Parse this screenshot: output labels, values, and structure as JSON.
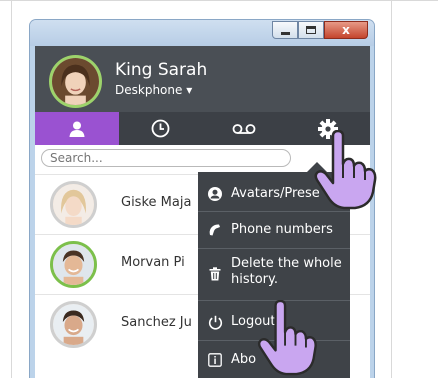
{
  "window": {
    "close_glyph": "x"
  },
  "user": {
    "name": "King Sarah",
    "device": "Deskphone ▾"
  },
  "tabs": [
    {
      "name": "contacts",
      "icon": "person-icon",
      "active": true
    },
    {
      "name": "history",
      "icon": "clock-icon",
      "active": false
    },
    {
      "name": "voicemail",
      "icon": "voicemail-icon",
      "active": false
    },
    {
      "name": "settings",
      "icon": "gear-icon",
      "active": false
    }
  ],
  "search": {
    "placeholder": "Search..."
  },
  "contacts": [
    {
      "name": "Giske Maja",
      "online": false
    },
    {
      "name": "Morvan Pi",
      "online": true
    },
    {
      "name": "Sanchez Ju",
      "online": false
    }
  ],
  "menu": {
    "items": [
      {
        "label": "Avatars/Prese",
        "icon": "avatar-icon"
      },
      {
        "label": "Phone numbers",
        "icon": "phone-icon"
      },
      {
        "label": "Delete the whole history.",
        "line1": "Delete the whole",
        "line2": "history.",
        "icon": "trash-icon"
      },
      {
        "label": "Logout",
        "icon": "power-icon"
      },
      {
        "label": "Abo",
        "icon": "info-icon"
      }
    ]
  },
  "colors": {
    "header_bg": "#4a4f55",
    "tab_active": "#9a52d1",
    "menu_bg": "#3f4348",
    "online_ring": "#7cc04b",
    "hand_cursor": "#c9a6f0"
  }
}
